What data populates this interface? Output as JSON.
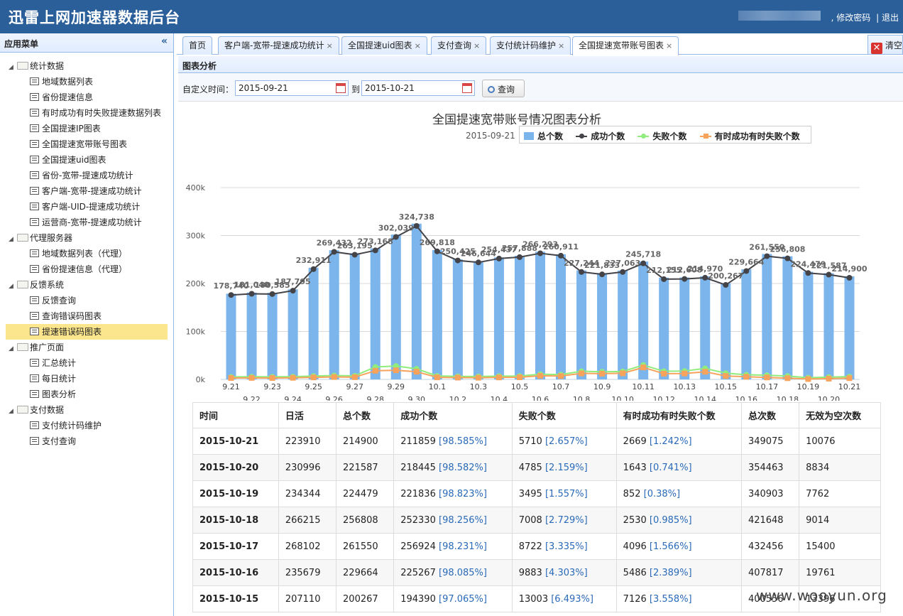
{
  "header": {
    "title": "迅雷上网加速器数据后台",
    "change_password": "修改密码",
    "separator": "|",
    "logout": "退出"
  },
  "sidebar": {
    "title": "应用菜单",
    "collapse_glyph": "«",
    "groups": [
      {
        "label": "统计数据",
        "items": [
          "地域数据列表",
          "省份提速信息",
          "有时成功有时失败提速数据列表",
          "全国提速IP图表",
          "全国提速宽带账号图表",
          "全国提速uid图表",
          "省份-宽带-提速成功统计",
          "客户端-宽带-提速成功统计",
          "客户端-UID-提速成功统计",
          "运营商-宽带-提速成功统计"
        ]
      },
      {
        "label": "代理服务器",
        "items": [
          "地域数据列表（代理）",
          "省份提速信息（代理）"
        ]
      },
      {
        "label": "反馈系统",
        "items": [
          "反馈查询",
          "查询错误码图表",
          "提速错误码图表"
        ]
      },
      {
        "label": "推广页面",
        "items": [
          "汇总统计",
          "每日统计",
          "图表分析"
        ]
      },
      {
        "label": "支付数据",
        "items": [
          "支付统计码维护",
          "支付查询"
        ]
      }
    ],
    "active_item": "提速错误码图表"
  },
  "tabs": [
    "首页",
    "客户端-宽带-提速成功统计",
    "全国提速uid图表",
    "支付查询",
    "支付统计码维护",
    "全国提速宽带账号图表"
  ],
  "tab_close_glyph": "×",
  "clear_label": "清空",
  "clear_glyph": "✕",
  "panel_title": "图表分析",
  "filter": {
    "label": "自定义时间：",
    "start": "2015-09-21",
    "to_label": "到",
    "end": "2015-10-21",
    "query_label": "查询"
  },
  "chart_data": {
    "type": "bar",
    "title": "全国提速宽带账号情况图表分析",
    "subtitle": "2015-09-21",
    "legend_placement": "top-right",
    "categories": [
      "9.21",
      "9.22",
      "9.23",
      "9.24",
      "9.25",
      "9.26",
      "9.27",
      "9.28",
      "9.29",
      "9.30",
      "10.1",
      "10.2",
      "10.3",
      "10.4",
      "10.5",
      "10.6",
      "10.7",
      "10.8",
      "10.9",
      "10.10",
      "10.11",
      "10.12",
      "10.13",
      "10.14",
      "10.15",
      "10.16",
      "10.17",
      "10.18",
      "10.19",
      "10.20",
      "10.21"
    ],
    "yticks": [
      "0k",
      "100k",
      "200k",
      "300k",
      "400k"
    ],
    "ylim": [
      0,
      400000
    ],
    "colors": {
      "total": "#7cb5ec",
      "success": "#434348",
      "fail": "#90ed7d",
      "sometimes": "#f7a35c"
    },
    "series": [
      {
        "name": "总个数",
        "values": [
          178740,
          181040,
          180585,
          187795,
          232911,
          269432,
          263195,
          273168,
          302039,
          324738,
          269818,
          250425,
          246644,
          254437,
          257888,
          266293,
          260911,
          227244,
          221833,
          227063,
          245718,
          212155,
          212608,
          214970,
          200267,
          229664,
          261550,
          256808,
          224479,
          221587,
          214900
        ]
      },
      {
        "name": "成功个数",
        "values": [
          176000,
          178500,
          178000,
          185000,
          230000,
          266000,
          260000,
          269000,
          297000,
          320000,
          267000,
          248000,
          244000,
          252000,
          255000,
          263000,
          258000,
          224000,
          219000,
          224000,
          242000,
          209000,
          209500,
          212000,
          197000,
          226000,
          256924,
          252330,
          221836,
          218445,
          211859
        ]
      },
      {
        "name": "失败个数",
        "values": [
          5200,
          5600,
          5300,
          5700,
          7000,
          8200,
          7500,
          26000,
          28000,
          22000,
          7300,
          6300,
          6100,
          6800,
          7100,
          11000,
          10000,
          17000,
          16000,
          16500,
          30000,
          17000,
          17500,
          23000,
          13003,
          9883,
          8722,
          7008,
          3495,
          4785,
          5710
        ]
      },
      {
        "name": "有时成功有时失败个数",
        "values": [
          3000,
          3200,
          3000,
          3400,
          4200,
          5100,
          4700,
          18000,
          19000,
          16000,
          4300,
          3800,
          3600,
          4200,
          4500,
          7600,
          7000,
          12500,
          12000,
          12700,
          25000,
          12000,
          12300,
          16000,
          7126,
          5486,
          4096,
          2530,
          852,
          1643,
          2669
        ]
      }
    ],
    "data_labels": [
      "178,740",
      "181,040",
      "180,585",
      "187,795",
      "232,911",
      "269,432",
      "263,195",
      "273,168",
      "302,039",
      "324,738",
      "269,818",
      "250,425",
      "246,644",
      "254,437",
      "257,888",
      "266,293",
      "260,911",
      "227,244",
      "221,833",
      "227,063",
      "245,718",
      "212,155",
      "212,608",
      "214,970",
      "200,267",
      "229,664",
      "261,550",
      "256,808",
      "224,479",
      "221,587",
      "214,900"
    ]
  },
  "table": {
    "headers": [
      "时间",
      "日活",
      "总个数",
      "成功个数",
      "失败个数",
      "有时成功有时失败个数",
      "总次数",
      "无效为空次数"
    ],
    "rows": [
      {
        "date": "2015-10-21",
        "dau": "223910",
        "total": "214900",
        "succ": "211859",
        "succ_pct": "[98.585%]",
        "fail": "5710",
        "fail_pct": "[2.657%]",
        "some": "2669",
        "some_pct": "[1.242%]",
        "times": "349075",
        "empty": "10076"
      },
      {
        "date": "2015-10-20",
        "dau": "230996",
        "total": "221587",
        "succ": "218445",
        "succ_pct": "[98.582%]",
        "fail": "4785",
        "fail_pct": "[2.159%]",
        "some": "1643",
        "some_pct": "[0.741%]",
        "times": "354463",
        "empty": "8834"
      },
      {
        "date": "2015-10-19",
        "dau": "234344",
        "total": "224479",
        "succ": "221836",
        "succ_pct": "[98.823%]",
        "fail": "3495",
        "fail_pct": "[1.557%]",
        "some": "852",
        "some_pct": "[0.38%]",
        "times": "340903",
        "empty": "7762"
      },
      {
        "date": "2015-10-18",
        "dau": "266215",
        "total": "256808",
        "succ": "252330",
        "succ_pct": "[98.256%]",
        "fail": "7008",
        "fail_pct": "[2.729%]",
        "some": "2530",
        "some_pct": "[0.985%]",
        "times": "421648",
        "empty": "9014"
      },
      {
        "date": "2015-10-17",
        "dau": "268102",
        "total": "261550",
        "succ": "256924",
        "succ_pct": "[98.231%]",
        "fail": "8722",
        "fail_pct": "[3.335%]",
        "some": "4096",
        "some_pct": "[1.566%]",
        "times": "432456",
        "empty": "15400"
      },
      {
        "date": "2015-10-16",
        "dau": "235679",
        "total": "229664",
        "succ": "225267",
        "succ_pct": "[98.085%]",
        "fail": "9883",
        "fail_pct": "[4.303%]",
        "some": "5486",
        "some_pct": "[2.389%]",
        "times": "407817",
        "empty": "19761"
      },
      {
        "date": "2015-10-15",
        "dau": "207110",
        "total": "200267",
        "succ": "194390",
        "succ_pct": "[97.065%]",
        "fail": "13003",
        "fail_pct": "[6.493%]",
        "some": "7126",
        "some_pct": "[3.558%]",
        "times": "400556",
        "empty": "13396"
      }
    ]
  },
  "watermark": "www.wooyun.org"
}
